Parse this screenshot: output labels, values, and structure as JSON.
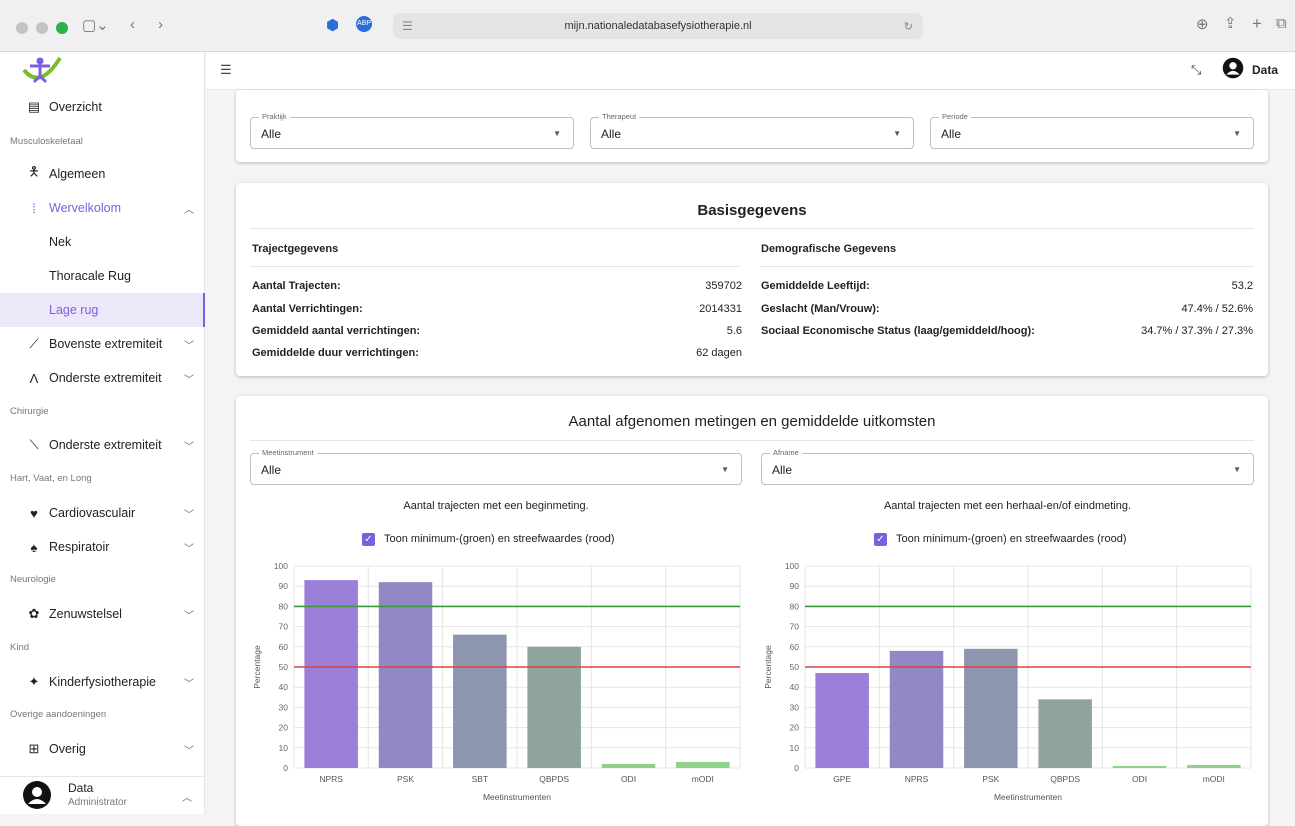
{
  "browser": {
    "url": "mijn.nationaledatabasefysiotherapie.nl"
  },
  "header": {
    "user_label": "Data"
  },
  "sidebar": {
    "overzicht": "Overzicht",
    "sections": [
      "Musculoskeletaal",
      "Chirurgie",
      "Hart, Vaat, en Long",
      "Neurologie",
      "Kind",
      "Overige aandoeningen"
    ],
    "items": {
      "algemeen": "Algemeen",
      "wervelkolom": "Wervelkolom",
      "nek": "Nek",
      "thoracale": "Thoracale Rug",
      "lage": "Lage rug",
      "bovenste": "Bovenste extremiteit",
      "onderste": "Onderste extremiteit",
      "onderste_chir": "Onderste extremiteit",
      "cardio": "Cardiovasculair",
      "resp": "Respiratoir",
      "zenuw": "Zenuwstelsel",
      "kinder": "Kinderfysiotherapie",
      "overig": "Overig"
    },
    "user": {
      "name": "Data",
      "role": "Administrator"
    }
  },
  "filters": [
    {
      "label": "Praktijk",
      "value": "Alle"
    },
    {
      "label": "Therapeut",
      "value": "Alle"
    },
    {
      "label": "Periode",
      "value": "Alle"
    }
  ],
  "basis": {
    "title": "Basisgegevens",
    "left_header": "Trajectgegevens",
    "right_header": "Demografische Gegevens",
    "left": [
      {
        "k": "Aantal Trajecten:",
        "v": "359702"
      },
      {
        "k": "Aantal Verrichtingen:",
        "v": "2014331"
      },
      {
        "k": "Gemiddeld aantal verrichtingen:",
        "v": "5.6"
      },
      {
        "k": "Gemiddelde duur verrichtingen:",
        "v": "62 dagen"
      }
    ],
    "right": [
      {
        "k": "Gemiddelde Leeftijd:",
        "v": "53.2"
      },
      {
        "k": "Geslacht (Man/Vrouw):",
        "v": "47.4% / 52.6%"
      },
      {
        "k": "Sociaal Economische Status (laag/gemiddeld/hoog):",
        "v": "34.7% / 37.3% / 27.3%"
      }
    ]
  },
  "metingen": {
    "title": "Aantal afgenomen metingen en gemiddelde uitkomsten",
    "filters": [
      {
        "label": "Meetinstrument",
        "value": "Alle"
      },
      {
        "label": "Afname",
        "value": "Alle"
      }
    ]
  },
  "chart_data": [
    {
      "type": "bar",
      "title": "Aantal trajecten met een beginmeting.",
      "checkbox": "Toon minimum-(groen) en streefwaardes (rood)",
      "categories": [
        "NPRS",
        "PSK",
        "SBT",
        "QBPDS",
        "ODI",
        "mODI"
      ],
      "values": [
        93,
        92,
        66,
        60,
        2,
        3
      ],
      "colors": [
        "#9b7fd9",
        "#9189c3",
        "#8e95af",
        "#8fa59c",
        "#8fd08a",
        "#8fd08a"
      ],
      "xlabel": "Meetinstrumenten",
      "ylabel": "Percentage",
      "ylim": [
        0,
        100
      ],
      "yticks": [
        0,
        10,
        20,
        30,
        40,
        50,
        60,
        70,
        80,
        90,
        100
      ],
      "reference_lines": [
        {
          "value": 80,
          "color": "#3a9a3a"
        },
        {
          "value": 50,
          "color": "#e04040"
        }
      ]
    },
    {
      "type": "bar",
      "title": "Aantal trajecten met een herhaal-en/of eindmeting.",
      "checkbox": "Toon minimum-(groen) en streefwaardes (rood)",
      "categories": [
        "GPE",
        "NPRS",
        "PSK",
        "QBPDS",
        "ODI",
        "mODI"
      ],
      "values": [
        47,
        58,
        59,
        34,
        1,
        1.5
      ],
      "colors": [
        "#9b7fd9",
        "#9189c3",
        "#8e95af",
        "#8fa59c",
        "#8fd08a",
        "#8fd08a"
      ],
      "xlabel": "Meetinstrumenten",
      "ylabel": "Percentage",
      "ylim": [
        0,
        100
      ],
      "yticks": [
        0,
        10,
        20,
        30,
        40,
        50,
        60,
        70,
        80,
        90,
        100
      ],
      "reference_lines": [
        {
          "value": 80,
          "color": "#3a9a3a"
        },
        {
          "value": 50,
          "color": "#e04040"
        }
      ]
    }
  ]
}
